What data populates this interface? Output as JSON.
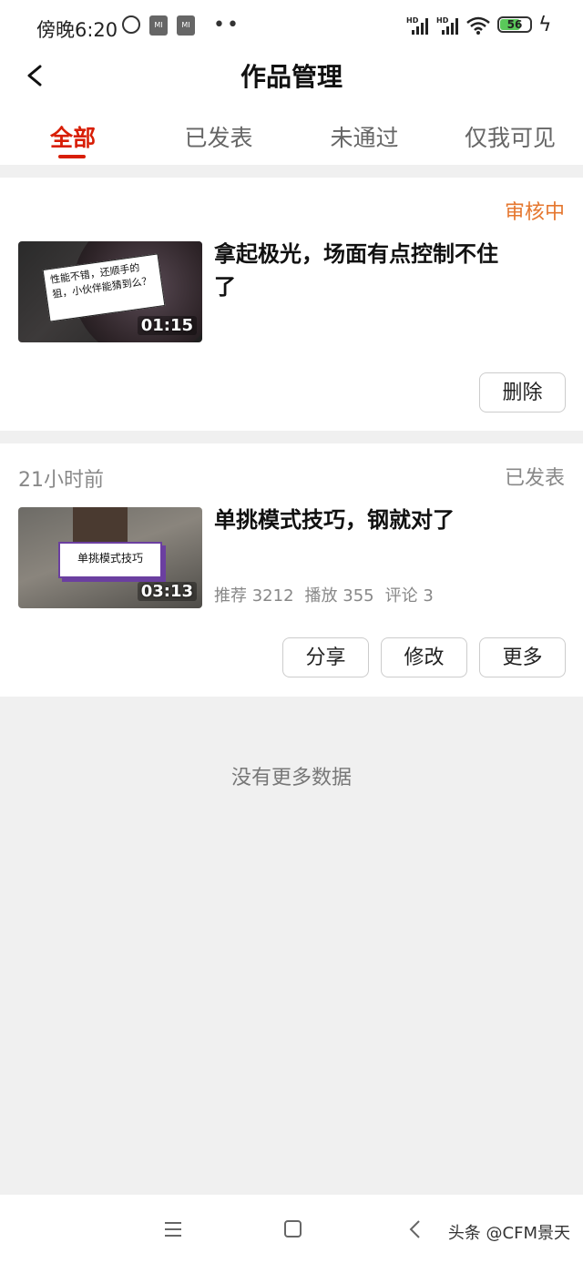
{
  "status_bar": {
    "time": "傍晚6:20",
    "mi_icon_text": "MI",
    "battery": "56",
    "network": [
      "HD",
      "HD"
    ]
  },
  "header": {
    "title": "作品管理"
  },
  "tabs": [
    {
      "label": "全部",
      "active": true
    },
    {
      "label": "已发表",
      "active": false
    },
    {
      "label": "未通过",
      "active": false
    },
    {
      "label": "仅我可见",
      "active": false
    }
  ],
  "works": [
    {
      "status": "审核中",
      "title": "拿起极光，场面有点控制不住了",
      "duration": "01:15",
      "thumbnail_note": "性能不错，还顺手的狙，小伙伴能猜到么？",
      "actions": [
        "删除"
      ]
    },
    {
      "time": "21小时前",
      "status": "已发表",
      "title": "单挑模式技巧，钢就对了",
      "duration": "03:13",
      "thumbnail_note": "单挑模式技巧",
      "stats": {
        "recommend": "推荐 3212",
        "play": "播放 355",
        "comment": "评论 3"
      },
      "actions": [
        "分享",
        "修改",
        "更多"
      ]
    }
  ],
  "footer_text": "没有更多数据",
  "watermark": "头条 @CFM景天",
  "colors": {
    "accent": "#d81e06",
    "review": "#e5772f",
    "muted": "#888888"
  }
}
